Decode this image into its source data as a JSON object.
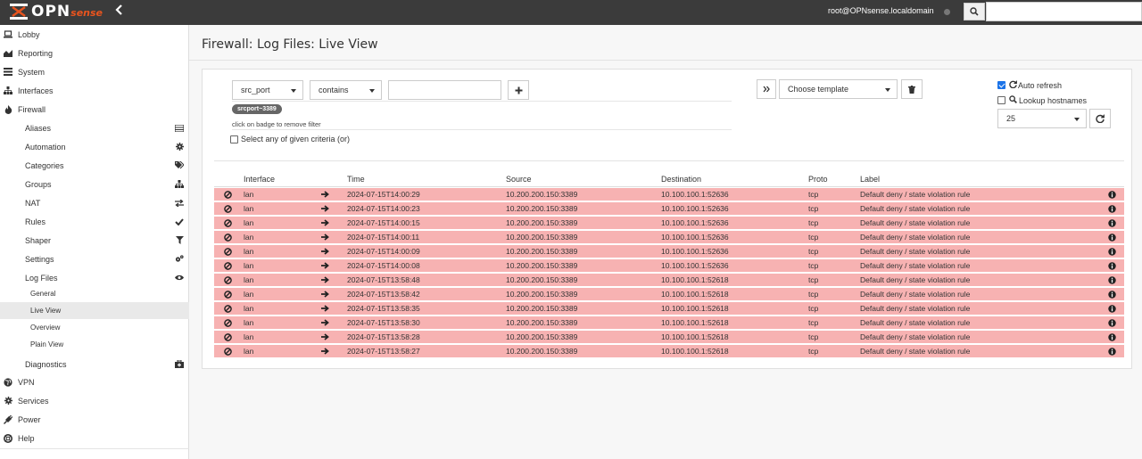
{
  "brand": {
    "name": "OPN",
    "suffix": "sense",
    "accent": "#e8541e"
  },
  "topbar": {
    "user": "root@OPNsense.localdomain",
    "search_placeholder": ""
  },
  "sidebar": {
    "items": [
      {
        "label": "Lobby",
        "icon": "laptop-icon"
      },
      {
        "label": "Reporting",
        "icon": "area-chart-icon"
      },
      {
        "label": "System",
        "icon": "server-icon"
      },
      {
        "label": "Interfaces",
        "icon": "sitemap-icon"
      },
      {
        "label": "Firewall",
        "icon": "fire-icon"
      },
      {
        "label": "Aliases",
        "icon": "list-icon"
      },
      {
        "label": "Automation",
        "icon": "cog-icon"
      },
      {
        "label": "Categories",
        "icon": "tags-icon"
      },
      {
        "label": "Groups",
        "icon": "sitemap-icon"
      },
      {
        "label": "NAT",
        "icon": "exchange-icon"
      },
      {
        "label": "Rules",
        "icon": "check-icon"
      },
      {
        "label": "Shaper",
        "icon": "filter-icon"
      },
      {
        "label": "Settings",
        "icon": "cogs-icon"
      },
      {
        "label": "Log Files",
        "icon": "eye-icon"
      },
      {
        "label": "General"
      },
      {
        "label": "Live View"
      },
      {
        "label": "Overview"
      },
      {
        "label": "Plain View"
      },
      {
        "label": "Diagnostics",
        "icon": "medkit-icon"
      },
      {
        "label": "VPN",
        "icon": "globe-icon"
      },
      {
        "label": "Services",
        "icon": "cog-icon"
      },
      {
        "label": "Power",
        "icon": "plug-icon"
      },
      {
        "label": "Help",
        "icon": "support-icon"
      }
    ],
    "active": "Live View"
  },
  "page": {
    "title": "Firewall: Log Files: Live View"
  },
  "filter": {
    "field": "src_port",
    "operator": "contains",
    "value": "",
    "badge": "srcport~3389",
    "badge_hint": "click on badge to remove filter",
    "any_criteria_label": "Select any of given criteria (or)",
    "template_placeholder": "Choose template",
    "auto_refresh_label": "Auto refresh",
    "auto_refresh_checked": true,
    "lookup_hostnames_label": "Lookup hostnames",
    "lookup_hostnames_checked": false,
    "page_size": "25"
  },
  "grid": {
    "columns": [
      "Interface",
      "Time",
      "Source",
      "Destination",
      "Proto",
      "Label"
    ],
    "row_color": "#f7b2b2",
    "rows": [
      {
        "interface": "lan",
        "time": "2024-07-15T14:00:29",
        "source": "10.200.200.150:3389",
        "destination": "10.100.100.1:52636",
        "proto": "tcp",
        "label": "Default deny / state violation rule"
      },
      {
        "interface": "lan",
        "time": "2024-07-15T14:00:23",
        "source": "10.200.200.150:3389",
        "destination": "10.100.100.1:52636",
        "proto": "tcp",
        "label": "Default deny / state violation rule"
      },
      {
        "interface": "lan",
        "time": "2024-07-15T14:00:15",
        "source": "10.200.200.150:3389",
        "destination": "10.100.100.1:52636",
        "proto": "tcp",
        "label": "Default deny / state violation rule"
      },
      {
        "interface": "lan",
        "time": "2024-07-15T14:00:11",
        "source": "10.200.200.150:3389",
        "destination": "10.100.100.1:52636",
        "proto": "tcp",
        "label": "Default deny / state violation rule"
      },
      {
        "interface": "lan",
        "time": "2024-07-15T14:00:09",
        "source": "10.200.200.150:3389",
        "destination": "10.100.100.1:52636",
        "proto": "tcp",
        "label": "Default deny / state violation rule"
      },
      {
        "interface": "lan",
        "time": "2024-07-15T14:00:08",
        "source": "10.200.200.150:3389",
        "destination": "10.100.100.1:52636",
        "proto": "tcp",
        "label": "Default deny / state violation rule"
      },
      {
        "interface": "lan",
        "time": "2024-07-15T13:58:48",
        "source": "10.200.200.150:3389",
        "destination": "10.100.100.1:52618",
        "proto": "tcp",
        "label": "Default deny / state violation rule"
      },
      {
        "interface": "lan",
        "time": "2024-07-15T13:58:42",
        "source": "10.200.200.150:3389",
        "destination": "10.100.100.1:52618",
        "proto": "tcp",
        "label": "Default deny / state violation rule"
      },
      {
        "interface": "lan",
        "time": "2024-07-15T13:58:35",
        "source": "10.200.200.150:3389",
        "destination": "10.100.100.1:52618",
        "proto": "tcp",
        "label": "Default deny / state violation rule"
      },
      {
        "interface": "lan",
        "time": "2024-07-15T13:58:30",
        "source": "10.200.200.150:3389",
        "destination": "10.100.100.1:52618",
        "proto": "tcp",
        "label": "Default deny / state violation rule"
      },
      {
        "interface": "lan",
        "time": "2024-07-15T13:58:28",
        "source": "10.200.200.150:3389",
        "destination": "10.100.100.1:52618",
        "proto": "tcp",
        "label": "Default deny / state violation rule"
      },
      {
        "interface": "lan",
        "time": "2024-07-15T13:58:27",
        "source": "10.200.200.150:3389",
        "destination": "10.100.100.1:52618",
        "proto": "tcp",
        "label": "Default deny / state violation rule"
      }
    ]
  }
}
